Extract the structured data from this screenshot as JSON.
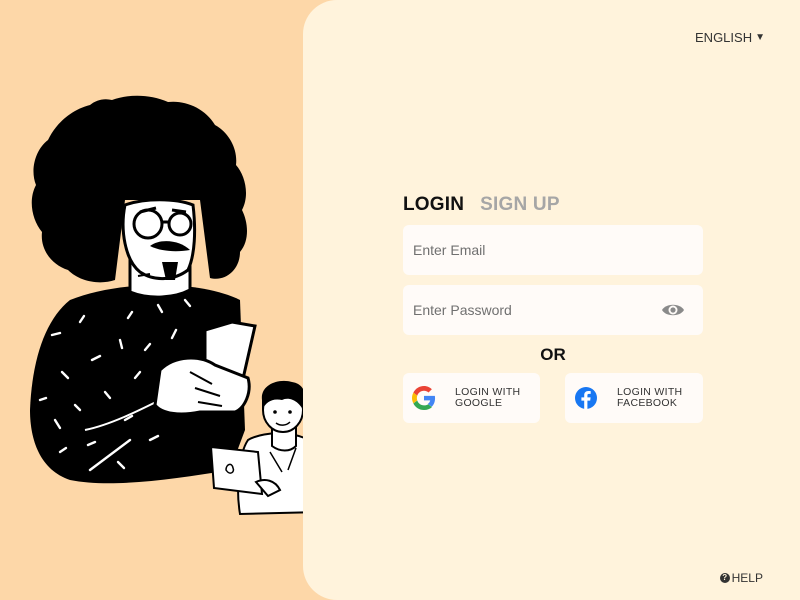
{
  "language": {
    "label": "ENGLISH",
    "caret_icon": "caret-down-icon"
  },
  "tabs": {
    "login": "LOGIN",
    "signup": "SIGN UP"
  },
  "form": {
    "email_placeholder": "Enter Email",
    "email_value": "",
    "password_placeholder": "Enter Password",
    "password_value": "",
    "or_text": "OR"
  },
  "social": {
    "google_line1": "LOGIN WITH",
    "google_line2": "GOOGLE",
    "facebook_line1": "LOGIN WITH",
    "facebook_line2": "FACEBOOK"
  },
  "help": {
    "label": "HELP",
    "icon": "question-icon"
  },
  "colors": {
    "background": "#FDD7A8",
    "panel": "#FFF3DC",
    "field": "#FFFBF8",
    "tab_active": "#111111",
    "tab_inactive": "#A6A6A6",
    "facebook_blue": "#1877F2"
  }
}
